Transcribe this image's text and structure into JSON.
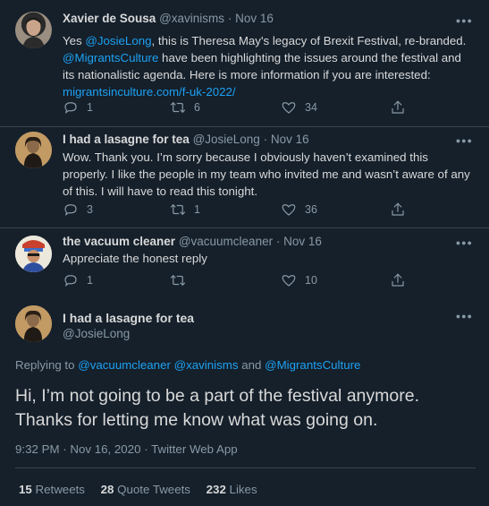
{
  "replies": [
    {
      "name": "Xavier de Sousa",
      "handle": "@xavinisms",
      "date": "Nov 16",
      "text_parts": [
        {
          "t": "Yes ",
          "link": false
        },
        {
          "t": "@JosieLong",
          "link": true
        },
        {
          "t": ", this is Theresa May's legacy of Brexit Festival, re-branded. ",
          "link": false
        },
        {
          "t": "@MigrantsCulture",
          "link": true
        },
        {
          "t": " have been highlighting the issues around the festival and its nationalistic agenda. Here is more information if you are interested: ",
          "link": false
        },
        {
          "t": "migrantsinculture.com/f-uk-2022/",
          "link": true
        }
      ],
      "reply_count": "1",
      "retweet_count": "6",
      "like_count": "34"
    },
    {
      "name": "I had a lasagne for tea",
      "handle": "@JosieLong",
      "date": "Nov 16",
      "text_parts": [
        {
          "t": "Wow. Thank you. I’m sorry because I obviously haven’t examined this properly. I like the people in my team who invited me and wasn’t aware of any of this. I will have to read this tonight.",
          "link": false
        }
      ],
      "reply_count": "3",
      "retweet_count": "1",
      "like_count": "36"
    },
    {
      "name": "the vacuum cleaner",
      "handle": "@vacuumcleaner",
      "date": "Nov 16",
      "text_parts": [
        {
          "t": "Appreciate the honest reply",
          "link": false
        }
      ],
      "reply_count": "1",
      "retweet_count": "",
      "like_count": "10"
    }
  ],
  "main": {
    "name": "I had a lasagne for tea",
    "handle": "@JosieLong",
    "replying_label": "Replying to",
    "replying_to": [
      "@vacuumcleaner",
      "@xavinisms",
      "@MigrantsCulture"
    ],
    "replying_and": "and",
    "text_line1": "Hi, I’m not going to be a part of the festival anymore.",
    "text_line2": "Thanks for letting me know what was going on.",
    "time": "9:32 PM",
    "date": "Nov 16, 2020",
    "client": "Twitter Web App",
    "retweets_count": "15",
    "retweets_label": "Retweets",
    "quotes_count": "28",
    "quotes_label": "Quote Tweets",
    "likes_count": "232",
    "likes_label": "Likes"
  },
  "separators": {
    "dot": "·"
  },
  "icons": {
    "reply": "reply-icon",
    "retweet": "retweet-icon",
    "like": "heart-icon",
    "share": "share-icon",
    "more": "more-icon"
  },
  "colors": {
    "background": "#15202b",
    "link": "#1da1f2",
    "secondary_text": "#8899a6",
    "primary_text": "#d9d9d9",
    "divider": "#38444d"
  }
}
